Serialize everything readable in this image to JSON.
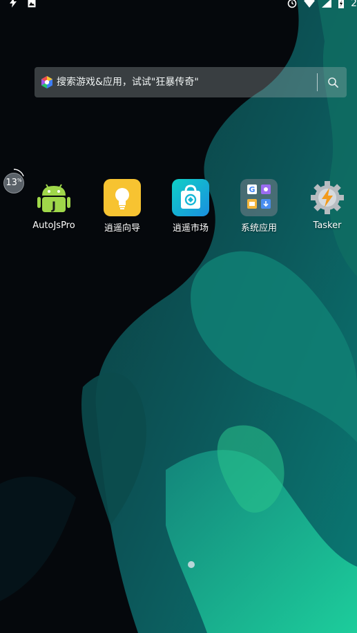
{
  "status_bar": {
    "left_icons": [
      "flash-icon",
      "image-icon"
    ],
    "right_icons": [
      "alarm-icon",
      "wifi-icon",
      "signal-icon",
      "battery-charging-icon"
    ],
    "clock_fragment": "2"
  },
  "search": {
    "placeholder": "搜索游戏&应用，试试\"狂暴传奇\"",
    "logo_icon": "app-store-logo-icon",
    "button_icon": "search-icon"
  },
  "memory_badge": {
    "value": "13",
    "unit": "%"
  },
  "apps": [
    {
      "label": "AutoJsPro",
      "icon": "android-j-icon"
    },
    {
      "label": "逍遥向导",
      "icon": "lightbulb-icon",
      "color": "#f7c331"
    },
    {
      "label": "逍遥市场",
      "icon": "shopping-bag-icon",
      "color": "#16b7d6"
    },
    {
      "label": "系统应用",
      "icon": "folder-icon"
    },
    {
      "label": "Tasker",
      "icon": "lightning-gear-icon"
    }
  ],
  "pager": {
    "pages": 1,
    "current": 1
  }
}
